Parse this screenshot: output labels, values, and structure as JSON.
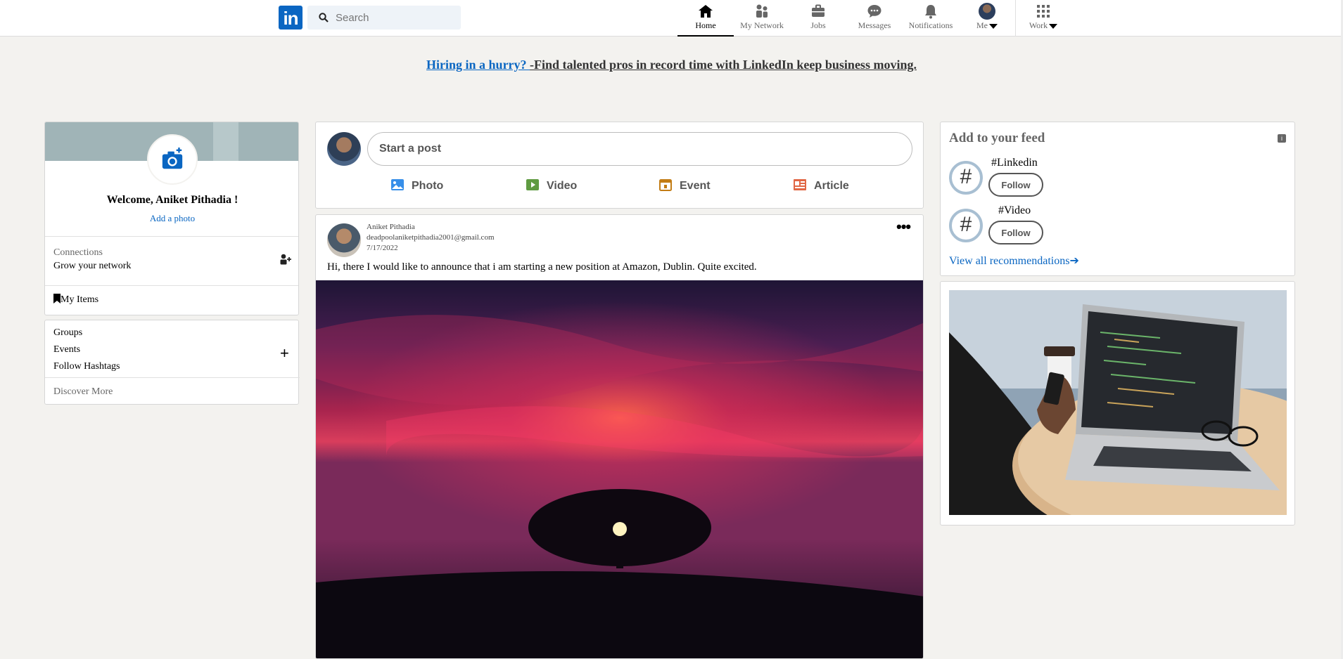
{
  "header": {
    "logo": "in",
    "search_placeholder": "Search",
    "nav": [
      {
        "label": "Home",
        "icon": "home-icon",
        "active": true
      },
      {
        "label": "My Network",
        "icon": "network-icon"
      },
      {
        "label": "Jobs",
        "icon": "briefcase-icon"
      },
      {
        "label": "Messages",
        "icon": "messages-icon"
      },
      {
        "label": "Notifications",
        "icon": "bell-icon"
      },
      {
        "label": "Me",
        "icon": "avatar"
      },
      {
        "label": "Work",
        "icon": "grid-icon"
      }
    ]
  },
  "banner": {
    "link": "Hiring in a hurry? ",
    "rest": "-Find talented pros in record time with LinkedIn keep business moving."
  },
  "profile": {
    "welcome": "Welcome, Aniket Pithadia !",
    "add_photo": "Add a photo",
    "connections_label": "Connections",
    "connections_sub": "Grow your network",
    "my_items": "My Items"
  },
  "links": {
    "groups": "Groups",
    "events": "Events",
    "hashtags": "Follow Hashtags",
    "discover": "Discover More"
  },
  "composer": {
    "placeholder": "Start a post",
    "actions": [
      {
        "label": "Photo",
        "color": "#378fe9"
      },
      {
        "label": "Video",
        "color": "#5f9b41"
      },
      {
        "label": "Event",
        "color": "#c37d16"
      },
      {
        "label": "Article",
        "color": "#e16745"
      }
    ]
  },
  "post": {
    "name": "Aniket Pithadia",
    "email": "deadpoolaniketpithadia2001@gmail.com",
    "date": "7/17/2022",
    "text": "Hi, there I would like to announce that i am starting a new position at Amazon, Dublin. Quite excited."
  },
  "feed": {
    "title": "Add to your feed",
    "tags": [
      {
        "name": "#Linkedin",
        "button": "Follow"
      },
      {
        "name": "#Video",
        "button": "Follow"
      }
    ],
    "view_all": "View all recommendations"
  },
  "colors": {
    "brand": "#0a66c2",
    "background": "#f3f2ef"
  }
}
